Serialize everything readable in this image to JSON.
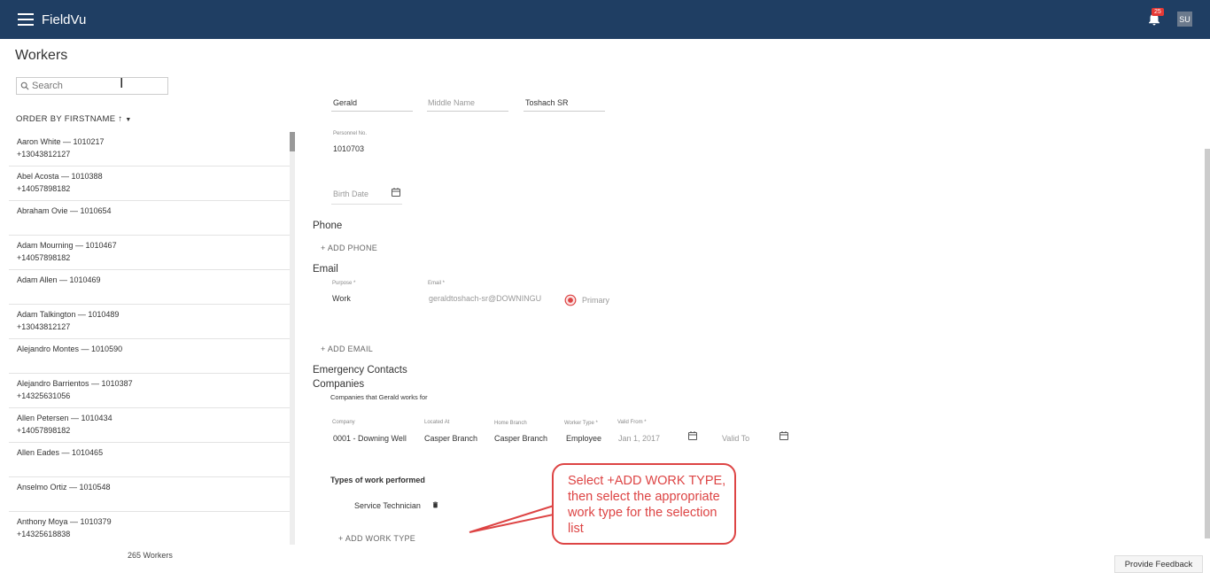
{
  "app": {
    "title": "FieldVu",
    "notification_count": "25",
    "user_initials": "SU"
  },
  "page": {
    "title": "Workers"
  },
  "search": {
    "placeholder": "Search"
  },
  "list": {
    "order_by": "ORDER BY FIRSTNAME",
    "workers": [
      {
        "name": "Aaron White  —  1010217",
        "phone": "+13043812127"
      },
      {
        "name": "Abel Acosta  —  1010388",
        "phone": "+14057898182"
      },
      {
        "name": "Abraham Ovie  —  1010654",
        "phone": ""
      },
      {
        "name": "Adam Mourning  —  1010467",
        "phone": "+14057898182"
      },
      {
        "name": "Adam Allen  —  1010469",
        "phone": ""
      },
      {
        "name": "Adam Talkington  —  1010489",
        "phone": "+13043812127"
      },
      {
        "name": "Alejandro Montes  —  1010590",
        "phone": ""
      },
      {
        "name": "Alejandro Barrientos  —  1010387",
        "phone": "+14325631056"
      },
      {
        "name": "Allen Petersen  —  1010434",
        "phone": "+14057898182"
      },
      {
        "name": "Allen Eades  —  1010465",
        "phone": ""
      },
      {
        "name": "Anselmo Ortiz  —  1010548",
        "phone": ""
      },
      {
        "name": "Anthony Moya  —  1010379",
        "phone": "+14325618838"
      }
    ],
    "count": "265 Workers"
  },
  "detail": {
    "first_name": "Gerald",
    "middle_name_placeholder": "Middle Name",
    "last_name": "Toshach SR",
    "personnel_label": "Personnel No.",
    "personnel_no": "1010703",
    "birth_date_placeholder": "Birth Date",
    "phone_heading": "Phone",
    "add_phone": "+ ADD PHONE",
    "email_heading": "Email",
    "purpose_label": "Purpose *",
    "purpose_value": "Work",
    "email_label": "Email *",
    "email_value": "geraldtoshach-sr@DOWNINGU",
    "primary_label": "Primary",
    "add_email": "+ ADD EMAIL",
    "emergency_heading": "Emergency Contacts",
    "companies_heading": "Companies",
    "companies_sub": "Companies that Gerald works for",
    "company_label": "Company",
    "company_value": "0001 - Downing Well",
    "located_label": "Located At",
    "located_value": "Casper Branch",
    "home_label": "Home Branch",
    "home_value": "Casper Branch",
    "worker_type_label": "Worker Type *",
    "worker_type_value": "Employee",
    "valid_from_label": "Valid From *",
    "valid_from_value": "Jan 1, 2017",
    "valid_to_placeholder": "Valid To",
    "work_types_heading": "Types of work performed",
    "work_type_item": "Service Technician",
    "add_work_type": "+ ADD WORK TYPE"
  },
  "callout": {
    "text": "Select +ADD WORK TYPE, then select the appropriate work type for the selection list"
  },
  "feedback": {
    "label": "Provide Feedback"
  },
  "colors": {
    "topbar": "#1f3e63",
    "accent": "#d44",
    "badge": "#e53935"
  }
}
